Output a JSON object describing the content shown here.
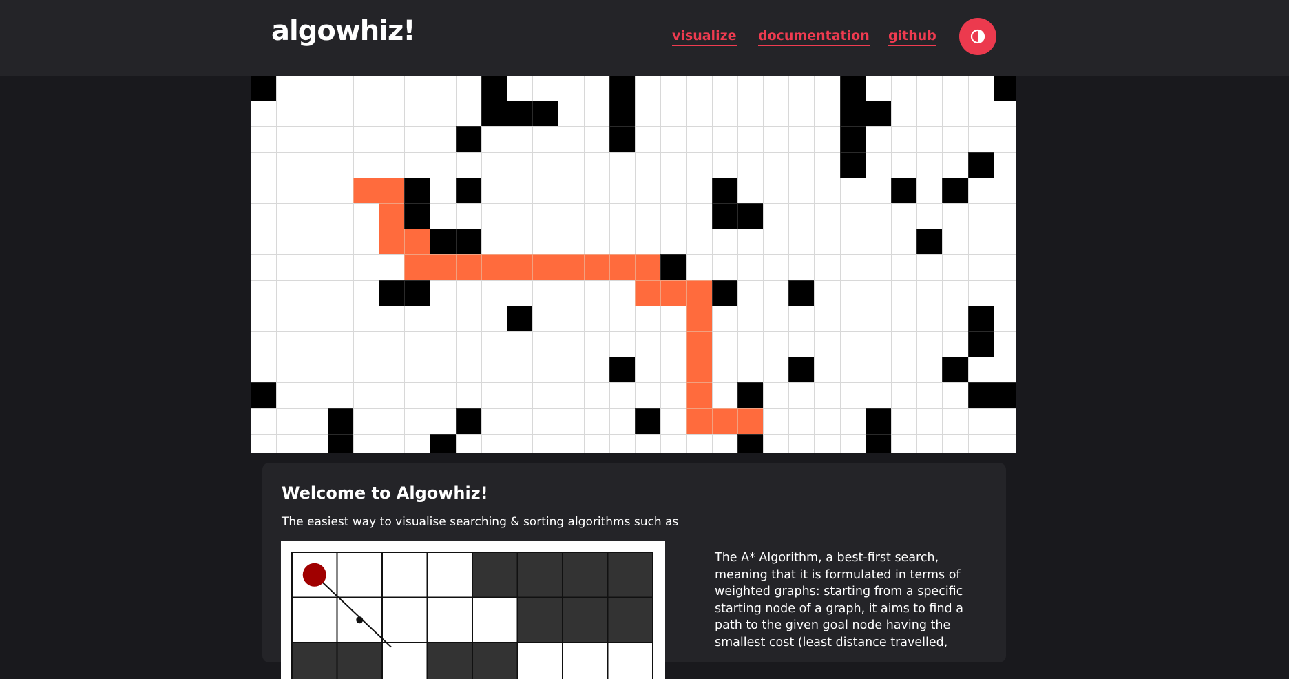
{
  "app": {
    "logo": "algowhiz!"
  },
  "nav": {
    "links": [
      {
        "label": "visualize"
      },
      {
        "label": "documentation"
      },
      {
        "label": "github"
      }
    ],
    "theme_toggle_icon": "contrast-icon"
  },
  "colors": {
    "accent": "#ef3b50",
    "path": "#ff6b3d",
    "wall": "#000000",
    "background": "#19191d",
    "navbar": "#242428"
  },
  "grid": {
    "cols": 30,
    "visible_rows": 15,
    "walls": [
      [
        0,
        0
      ],
      [
        0,
        9
      ],
      [
        0,
        14
      ],
      [
        0,
        23
      ],
      [
        0,
        29
      ],
      [
        1,
        9
      ],
      [
        1,
        10
      ],
      [
        1,
        11
      ],
      [
        1,
        14
      ],
      [
        1,
        23
      ],
      [
        1,
        24
      ],
      [
        2,
        8
      ],
      [
        2,
        14
      ],
      [
        2,
        23
      ],
      [
        3,
        23
      ],
      [
        3,
        28
      ],
      [
        4,
        6
      ],
      [
        4,
        8
      ],
      [
        4,
        18
      ],
      [
        4,
        25
      ],
      [
        4,
        27
      ],
      [
        5,
        6
      ],
      [
        5,
        18
      ],
      [
        5,
        19
      ],
      [
        6,
        7
      ],
      [
        6,
        8
      ],
      [
        6,
        26
      ],
      [
        7,
        16
      ],
      [
        8,
        5
      ],
      [
        8,
        6
      ],
      [
        8,
        18
      ],
      [
        8,
        21
      ],
      [
        9,
        10
      ],
      [
        9,
        28
      ],
      [
        10,
        28
      ],
      [
        11,
        14
      ],
      [
        11,
        21
      ],
      [
        11,
        27
      ],
      [
        12,
        0
      ],
      [
        12,
        19
      ],
      [
        12,
        28
      ],
      [
        12,
        29
      ],
      [
        13,
        3
      ],
      [
        13,
        8
      ],
      [
        13,
        15
      ],
      [
        13,
        24
      ],
      [
        14,
        3
      ],
      [
        14,
        7
      ],
      [
        14,
        19
      ],
      [
        14,
        24
      ]
    ],
    "path": [
      [
        4,
        4
      ],
      [
        4,
        5
      ],
      [
        5,
        5
      ],
      [
        6,
        5
      ],
      [
        6,
        6
      ],
      [
        7,
        6
      ],
      [
        7,
        7
      ],
      [
        7,
        8
      ],
      [
        7,
        9
      ],
      [
        7,
        10
      ],
      [
        7,
        11
      ],
      [
        7,
        12
      ],
      [
        7,
        13
      ],
      [
        7,
        14
      ],
      [
        7,
        15
      ],
      [
        8,
        15
      ],
      [
        8,
        16
      ],
      [
        8,
        17
      ],
      [
        9,
        17
      ],
      [
        10,
        17
      ],
      [
        11,
        17
      ],
      [
        12,
        17
      ],
      [
        13,
        17
      ],
      [
        13,
        18
      ],
      [
        13,
        19
      ]
    ]
  },
  "welcome": {
    "title": "Welcome to Algowhiz!",
    "subtitle": "The easiest way to visualise searching & sorting algorithms such as",
    "description": "The A* Algorithm, a best-first search, meaning that it is formulated in terms of weighted graphs: starting from a specific starting node of a graph, it aims to find a path to the given goal node having the smallest cost (least distance travelled,"
  },
  "demo": {
    "cols": 8,
    "rows": 3,
    "dark_cells": [
      [
        0,
        4
      ],
      [
        0,
        5
      ],
      [
        0,
        6
      ],
      [
        0,
        7
      ],
      [
        1,
        5
      ],
      [
        1,
        6
      ],
      [
        1,
        7
      ],
      [
        2,
        0
      ],
      [
        2,
        1
      ],
      [
        2,
        3
      ],
      [
        2,
        4
      ]
    ],
    "start_icon": "start-node-icon"
  }
}
